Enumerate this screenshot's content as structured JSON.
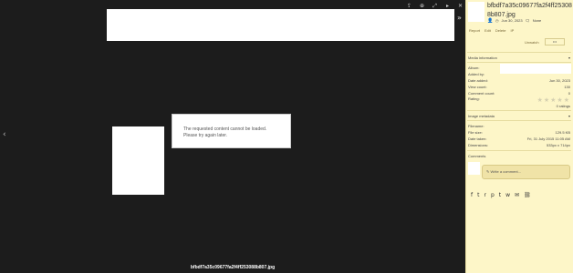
{
  "viewer": {
    "toolbar_icons": [
      "share-icon",
      "zoom-in-icon",
      "fullscreen-icon",
      "slideshow-icon",
      "close-icon"
    ],
    "toolbar_glyphs": [
      "⇪",
      "⊕",
      "⤢",
      "▸",
      "✕"
    ],
    "nav_prev": "‹",
    "nav_next": "›",
    "expand_glyph": "»",
    "error_message": "The requested content cannot be loaded. Please try again later.",
    "caption": "bfbdf7a35c09677fa2f4ff253088b807.jpg"
  },
  "sidebar": {
    "title": "bfbdf7a35c09677fa2f4ff253088b807.jpg",
    "date": "Jun 30, 2023",
    "comments_count": "None",
    "actions": [
      "Report",
      "Edit",
      "Delete",
      "IP"
    ],
    "unwatch": "Unwatch",
    "more": "•••",
    "media_info": {
      "heading": "Media information",
      "album_label": "Album:",
      "added_by_label": "Added by:",
      "date_added_label": "Date added:",
      "date_added": "Jun 30, 2023",
      "view_count_label": "View count:",
      "view_count": "130",
      "comment_count_label": "Comment count:",
      "comment_count": "0",
      "rating_label": "Rating:",
      "rating_value": 0,
      "ratings_text": "0 ratings"
    },
    "image_meta": {
      "heading": "Image metadata",
      "filename_label": "Filename:",
      "file_size_label": "File size:",
      "file_size": "129.5 KB",
      "date_taken_label": "Date taken:",
      "date_taken": "Fri, 31 July 2015 11:05 AM",
      "dimensions_label": "Dimensions:",
      "dimensions": "533px x 714px"
    },
    "comments": {
      "heading": "Comments",
      "placeholder": "Write a comment..."
    },
    "share_icons": [
      "facebook-icon",
      "twitter-icon",
      "reddit-icon",
      "pinterest-icon",
      "tumblr-icon",
      "whatsapp-icon",
      "email-icon",
      "link-icon"
    ],
    "share_glyphs": [
      "f",
      "t",
      "r",
      "p",
      "t",
      "w",
      "✉",
      "⛓"
    ]
  }
}
